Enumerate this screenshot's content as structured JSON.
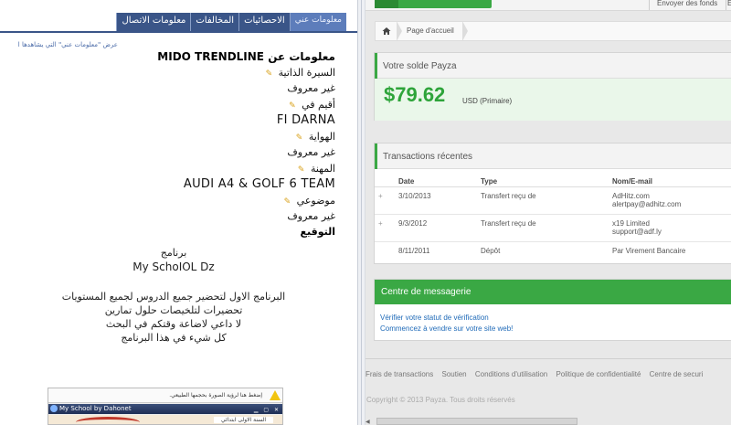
{
  "left": {
    "tabs": [
      "معلومات عني",
      "الاحصائيات",
      "المخالفات",
      "معلومات الاتصال"
    ],
    "subnote": "عرض \"معلومات عني\" التي يشاهدها ا",
    "profile_title": "معلومات عن MIDO TRENDLINE",
    "fields": [
      {
        "label": "السيرة الذاتية",
        "value": "غير معروف"
      },
      {
        "label": "أقيم في",
        "value": "FI DARNA"
      },
      {
        "label": "الهواية",
        "value": "غير معروف"
      },
      {
        "label": "المهنة",
        "value": "AUDI A4 & GOLF 6 TEAM"
      },
      {
        "label": "موضوعي",
        "value": "غير معروف"
      }
    ],
    "signature_heading": "التوقيع",
    "signature": {
      "line1": "برنامج",
      "line2": "My SchoIOL Dz",
      "body": [
        "البرنامج الاول لتحضير جميع الدروس لجميع المستويات",
        "تحضيرات لتلخيصات حلول تمارين",
        "لا داعي لاضاعة وقتكم في البحث",
        "كل شيء في هذا البرنامج"
      ]
    },
    "embed": {
      "warning": "إضغط هنا لرؤية الصورة بحجمها الطبيعي.",
      "window_title": "My School by Dahonet",
      "content_label": "السنة الاولى ابتدائي"
    }
  },
  "right": {
    "topbar": {
      "send_funds": "Envoyer des fonds",
      "cut_item": "E"
    },
    "breadcrumb": {
      "home_icon": "home-icon",
      "label": "Page d'accueil"
    },
    "balance": {
      "heading": "Votre solde Payza",
      "amount": "$79.62",
      "currency_note": "USD (Primaire)"
    },
    "transactions": {
      "heading": "Transactions récentes",
      "columns": [
        "Date",
        "Type",
        "Nom/E-mail"
      ],
      "rows": [
        {
          "expand": "+",
          "date": "3/10/2013",
          "type": "Transfert reçu de",
          "name": "AdHitz.com",
          "email": "alertpay@adhitz.com"
        },
        {
          "expand": "+",
          "date": "9/3/2012",
          "type": "Transfert reçu de",
          "name": "x19 Limited",
          "email": "support@adf.ly"
        },
        {
          "expand": "",
          "date": "8/11/2011",
          "type": "Dépôt",
          "name": "Par Virement Bancaire",
          "email": ""
        }
      ]
    },
    "messages": {
      "heading": "Centre de messagerie",
      "links": [
        "Vérifier votre statut de vérification",
        "Commencez à vendre sur votre site web!"
      ]
    },
    "footer": {
      "links": [
        "Frais de transactions",
        "Soutien",
        "Conditions d'utilisation",
        "Politique de confidentialité",
        "Centre de securi"
      ],
      "copyright": "Copyright © 2013 Payza. Tous droits réservés"
    },
    "colors": {
      "brand_green": "#3aa844",
      "link_blue": "#1f6ab8",
      "left_accent": "#3a5588"
    }
  }
}
